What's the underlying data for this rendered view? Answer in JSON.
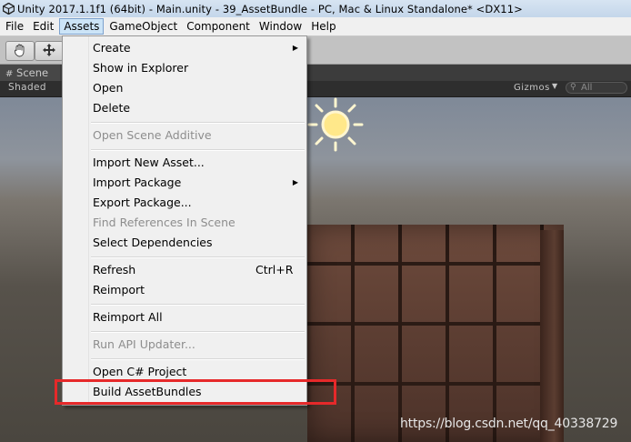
{
  "window": {
    "title": "Unity 2017.1.1f1 (64bit) - Main.unity - 39_AssetBundle - PC, Mac & Linux Standalone* <DX11>"
  },
  "menubar": {
    "items": [
      "File",
      "Edit",
      "Assets",
      "GameObject",
      "Component",
      "Window",
      "Help"
    ],
    "active": "Assets"
  },
  "scene": {
    "tab_label": "Scene",
    "shading_mode": "Shaded",
    "gizmos_label": "Gizmos",
    "search_placeholder": "All"
  },
  "assets_menu": {
    "create": "Create",
    "show_in_explorer": "Show in Explorer",
    "open": "Open",
    "delete": "Delete",
    "open_scene_additive": "Open Scene Additive",
    "import_new_asset": "Import New Asset...",
    "import_package": "Import Package",
    "export_package": "Export Package...",
    "find_references": "Find References In Scene",
    "select_dependencies": "Select Dependencies",
    "refresh": "Refresh",
    "refresh_shortcut": "Ctrl+R",
    "reimport": "Reimport",
    "reimport_all": "Reimport All",
    "run_api_updater": "Run API Updater...",
    "open_csharp_project": "Open C# Project",
    "build_assetbundles": "Build AssetBundles"
  },
  "watermark": "https://blog.csdn.net/qq_40338729",
  "colors": {
    "highlight": "#e6292a",
    "menu_bg": "#f0f0f0",
    "disabled_text": "#8d8d8d"
  }
}
